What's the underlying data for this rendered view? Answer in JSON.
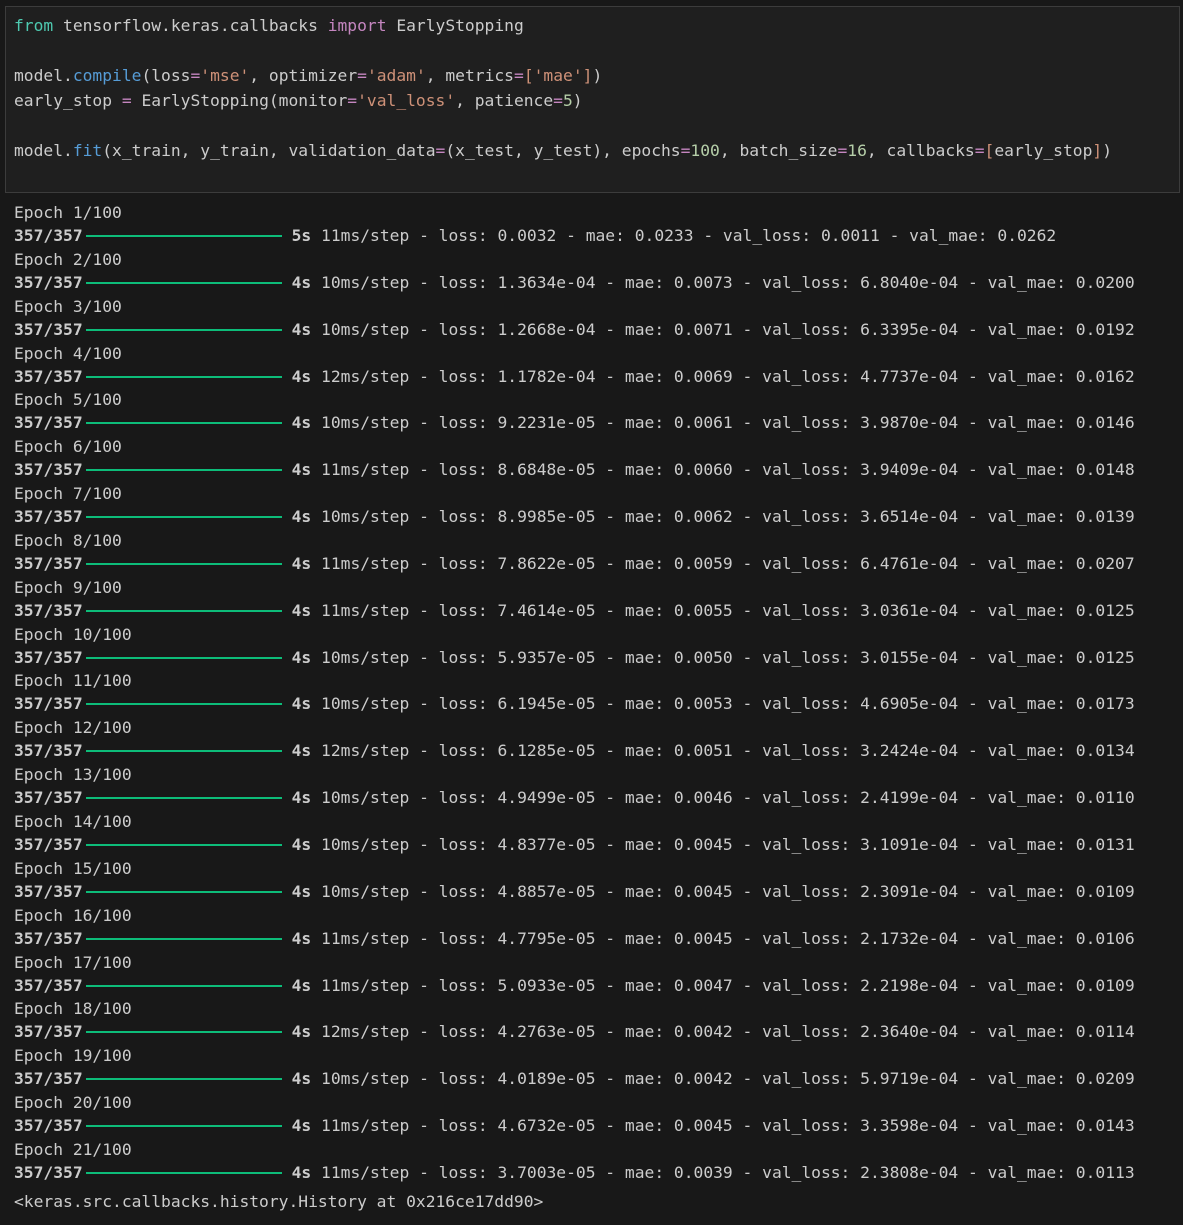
{
  "code": {
    "line1": {
      "kw_from": "from",
      "module": " tensorflow.keras.callbacks ",
      "kw_import": "import",
      "name": " EarlyStopping"
    },
    "line3": {
      "obj": "model.",
      "fn": "compile",
      "p1": "(loss",
      "eq1": "=",
      "s1": "'mse'",
      "p2": ", optimizer",
      "eq2": "=",
      "s2": "'adam'",
      "p3": ", metrics",
      "eq3": "=",
      "lb": "[",
      "s3": "'mae'",
      "rb": "]",
      "p4": ")"
    },
    "line4": {
      "p1": "early_stop ",
      "eq1": "=",
      "p2": " EarlyStopping(monitor",
      "eq2": "=",
      "s1": "'val_loss'",
      "p3": ", patience",
      "eq3": "=",
      "n1": "5",
      "p4": ")"
    },
    "line6": {
      "obj": "model.",
      "fn": "fit",
      "p1": "(x_train, y_train, validation_data",
      "eq1": "=",
      "p2": "(x_test, y_test), epochs",
      "eq2": "=",
      "n1": "100",
      "p3": ", batch_size",
      "eq3": "=",
      "n2": "16",
      "p4": ", callbacks",
      "eq4": "=",
      "lb": "[",
      "p5": "early_stop",
      "rb": "]",
      "p6": ")"
    }
  },
  "output": {
    "epochs": [
      {
        "epoch": "Epoch 1/100",
        "steps": "357/357",
        "time": "5s",
        "metrics": "11ms/step - loss: 0.0032 - mae: 0.0233 - val_loss: 0.0011 - val_mae: 0.0262"
      },
      {
        "epoch": "Epoch 2/100",
        "steps": "357/357",
        "time": "4s",
        "metrics": "10ms/step - loss: 1.3634e-04 - mae: 0.0073 - val_loss: 6.8040e-04 - val_mae: 0.0200"
      },
      {
        "epoch": "Epoch 3/100",
        "steps": "357/357",
        "time": "4s",
        "metrics": "10ms/step - loss: 1.2668e-04 - mae: 0.0071 - val_loss: 6.3395e-04 - val_mae: 0.0192"
      },
      {
        "epoch": "Epoch 4/100",
        "steps": "357/357",
        "time": "4s",
        "metrics": "12ms/step - loss: 1.1782e-04 - mae: 0.0069 - val_loss: 4.7737e-04 - val_mae: 0.0162"
      },
      {
        "epoch": "Epoch 5/100",
        "steps": "357/357",
        "time": "4s",
        "metrics": "10ms/step - loss: 9.2231e-05 - mae: 0.0061 - val_loss: 3.9870e-04 - val_mae: 0.0146"
      },
      {
        "epoch": "Epoch 6/100",
        "steps": "357/357",
        "time": "4s",
        "metrics": "11ms/step - loss: 8.6848e-05 - mae: 0.0060 - val_loss: 3.9409e-04 - val_mae: 0.0148"
      },
      {
        "epoch": "Epoch 7/100",
        "steps": "357/357",
        "time": "4s",
        "metrics": "10ms/step - loss: 8.9985e-05 - mae: 0.0062 - val_loss: 3.6514e-04 - val_mae: 0.0139"
      },
      {
        "epoch": "Epoch 8/100",
        "steps": "357/357",
        "time": "4s",
        "metrics": "11ms/step - loss: 7.8622e-05 - mae: 0.0059 - val_loss: 6.4761e-04 - val_mae: 0.0207"
      },
      {
        "epoch": "Epoch 9/100",
        "steps": "357/357",
        "time": "4s",
        "metrics": "11ms/step - loss: 7.4614e-05 - mae: 0.0055 - val_loss: 3.0361e-04 - val_mae: 0.0125"
      },
      {
        "epoch": "Epoch 10/100",
        "steps": "357/357",
        "time": "4s",
        "metrics": "10ms/step - loss: 5.9357e-05 - mae: 0.0050 - val_loss: 3.0155e-04 - val_mae: 0.0125"
      },
      {
        "epoch": "Epoch 11/100",
        "steps": "357/357",
        "time": "4s",
        "metrics": "10ms/step - loss: 6.1945e-05 - mae: 0.0053 - val_loss: 4.6905e-04 - val_mae: 0.0173"
      },
      {
        "epoch": "Epoch 12/100",
        "steps": "357/357",
        "time": "4s",
        "metrics": "12ms/step - loss: 6.1285e-05 - mae: 0.0051 - val_loss: 3.2424e-04 - val_mae: 0.0134"
      },
      {
        "epoch": "Epoch 13/100",
        "steps": "357/357",
        "time": "4s",
        "metrics": "10ms/step - loss: 4.9499e-05 - mae: 0.0046 - val_loss: 2.4199e-04 - val_mae: 0.0110"
      },
      {
        "epoch": "Epoch 14/100",
        "steps": "357/357",
        "time": "4s",
        "metrics": "10ms/step - loss: 4.8377e-05 - mae: 0.0045 - val_loss: 3.1091e-04 - val_mae: 0.0131"
      },
      {
        "epoch": "Epoch 15/100",
        "steps": "357/357",
        "time": "4s",
        "metrics": "10ms/step - loss: 4.8857e-05 - mae: 0.0045 - val_loss: 2.3091e-04 - val_mae: 0.0109"
      },
      {
        "epoch": "Epoch 16/100",
        "steps": "357/357",
        "time": "4s",
        "metrics": "11ms/step - loss: 4.7795e-05 - mae: 0.0045 - val_loss: 2.1732e-04 - val_mae: 0.0106"
      },
      {
        "epoch": "Epoch 17/100",
        "steps": "357/357",
        "time": "4s",
        "metrics": "11ms/step - loss: 5.0933e-05 - mae: 0.0047 - val_loss: 2.2198e-04 - val_mae: 0.0109"
      },
      {
        "epoch": "Epoch 18/100",
        "steps": "357/357",
        "time": "4s",
        "metrics": "12ms/step - loss: 4.2763e-05 - mae: 0.0042 - val_loss: 2.3640e-04 - val_mae: 0.0114"
      },
      {
        "epoch": "Epoch 19/100",
        "steps": "357/357",
        "time": "4s",
        "metrics": "10ms/step - loss: 4.0189e-05 - mae: 0.0042 - val_loss: 5.9719e-04 - val_mae: 0.0209"
      },
      {
        "epoch": "Epoch 20/100",
        "steps": "357/357",
        "time": "4s",
        "metrics": "11ms/step - loss: 4.6732e-05 - mae: 0.0045 - val_loss: 3.3598e-04 - val_mae: 0.0143"
      },
      {
        "epoch": "Epoch 21/100",
        "steps": "357/357",
        "time": "4s",
        "metrics": "11ms/step - loss: 3.7003e-05 - mae: 0.0039 - val_loss: 2.3808e-04 - val_mae: 0.0113"
      }
    ],
    "result": "<keras.src.callbacks.history.History at 0x216ce17dd90>"
  },
  "colors": {
    "background": "#181818",
    "cell_background": "#1f1f1f",
    "progress_bar": "#0dbc79",
    "keyword_from": "#4ec9b0",
    "keyword_import": "#c586c0",
    "function": "#569cd6",
    "string": "#ce9178",
    "number": "#b5cea8"
  }
}
